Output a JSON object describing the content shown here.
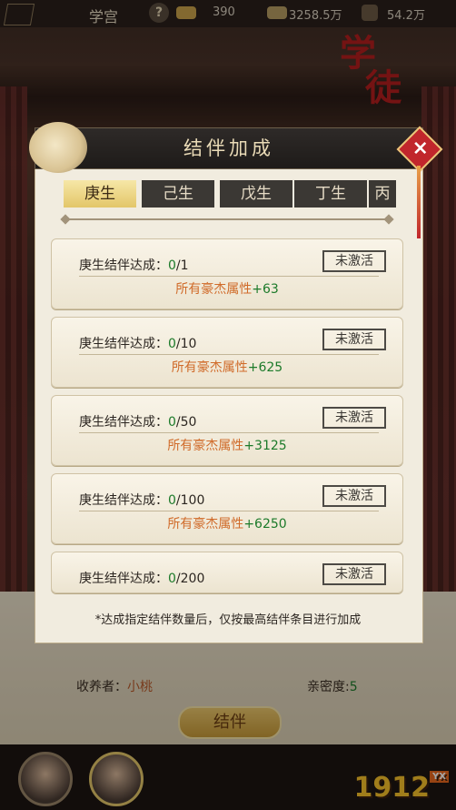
{
  "topbar": {
    "title": "学宫",
    "help": "?",
    "gold": "390",
    "silver": "3258.5万",
    "power": "54.2万"
  },
  "school_emblem": [
    "学",
    "徒"
  ],
  "modal": {
    "title": "结伴加成",
    "close": "×",
    "tabs": [
      "庚生",
      "己生",
      "戊生",
      "丁生",
      "丙"
    ],
    "active_tab": 0,
    "cards": [
      {
        "label": "庚生结伴达成：",
        "progress": "0",
        "total": "/1",
        "stamp": "未激活",
        "reward_text": "所有豪杰属性",
        "reward_value": "+63"
      },
      {
        "label": "庚生结伴达成：",
        "progress": "0",
        "total": "/10",
        "stamp": "未激活",
        "reward_text": "所有豪杰属性",
        "reward_value": "+625"
      },
      {
        "label": "庚生结伴达成：",
        "progress": "0",
        "total": "/50",
        "stamp": "未激活",
        "reward_text": "所有豪杰属性",
        "reward_value": "+3125"
      },
      {
        "label": "庚生结伴达成：",
        "progress": "0",
        "total": "/100",
        "stamp": "未激活",
        "reward_text": "所有豪杰属性",
        "reward_value": "+6250"
      },
      {
        "label": "庚生结伴达成：",
        "progress": "0",
        "total": "/200",
        "stamp": "未激活",
        "reward_text": "",
        "reward_value": ""
      }
    ],
    "note": "*达成指定结伴数量后，仅按最高结伴条目进行加成"
  },
  "background": {
    "receiver_label": "收养者：",
    "receiver_name": "小桃",
    "intimacy_label": "亲密度:",
    "intimacy_value": "5",
    "bond_button": "结伴"
  },
  "logo": {
    "text": "1912",
    "badge": "YX"
  },
  "colors": {
    "accent_green": "#1c7a2a",
    "reward_orange": "#d06b2a",
    "close_red": "#c1262c",
    "tab_gold": "#e3c669"
  }
}
